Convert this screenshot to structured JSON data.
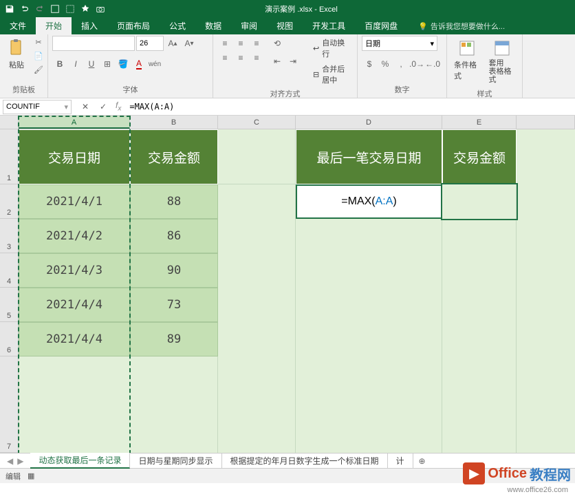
{
  "app_title": "演示案例 .xlsx - Excel",
  "tabs": {
    "file": "文件",
    "home": "开始",
    "insert": "插入",
    "layout": "页面布局",
    "formula": "公式",
    "data": "数据",
    "review": "审阅",
    "view": "视图",
    "dev": "开发工具",
    "baidu": "百度网盘"
  },
  "tell_me": "告诉我您想要做什么...",
  "ribbon": {
    "clipboard": {
      "paste": "粘贴",
      "label": "剪贴板"
    },
    "font": {
      "size": "26",
      "label": "字体"
    },
    "align": {
      "wrap": "自动换行",
      "merge": "合并后居中",
      "label": "对齐方式"
    },
    "number": {
      "format": "日期",
      "label": "数字"
    },
    "styles": {
      "cond": "条件格式",
      "table": "套用\n表格格式",
      "label": "样式"
    }
  },
  "namebox": "COUNTIF",
  "formula": "=MAX(A:A)",
  "headers": {
    "A": "交易日期",
    "B": "交易金额",
    "D": "最后一笔交易日期",
    "E": "交易金额"
  },
  "data_rows": [
    {
      "date": "2021/4/1",
      "amount": "88"
    },
    {
      "date": "2021/4/2",
      "amount": "86"
    },
    {
      "date": "2021/4/3",
      "amount": "90"
    },
    {
      "date": "2021/4/4",
      "amount": "73"
    },
    {
      "date": "2021/4/4",
      "amount": "89"
    }
  ],
  "editing_cell": {
    "prefix": "=MAX(",
    "ref": "A:A",
    "suffix": ")"
  },
  "cols": [
    "A",
    "B",
    "C",
    "D",
    "E"
  ],
  "rows": [
    "1",
    "2",
    "3",
    "4",
    "5",
    "6",
    "7"
  ],
  "sheets": {
    "s1": "动态获取最后一条记录",
    "s2": "日期与星期同步显示",
    "s3": "根据提定的年月日数字生成一个标准日期",
    "s4": "计"
  },
  "status": "编辑",
  "watermark": {
    "brand1": "Office",
    "brand2": "教程网",
    "url": "www.office26.com"
  }
}
